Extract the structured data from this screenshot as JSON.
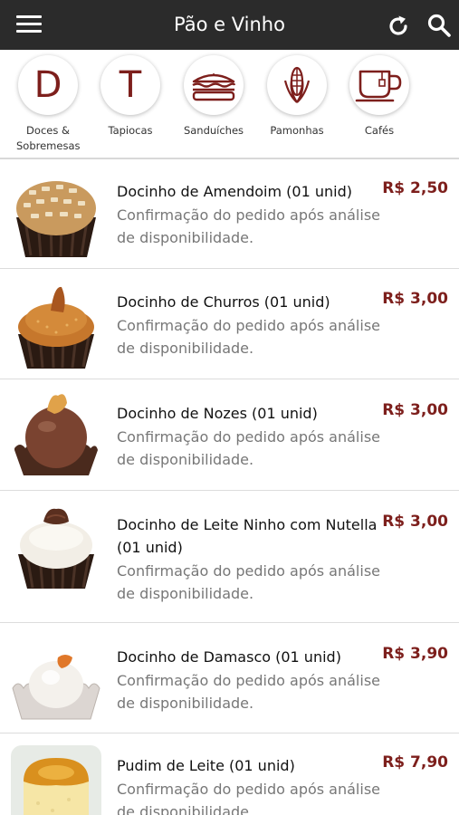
{
  "app": {
    "title": "Pão e Vinho"
  },
  "categories": [
    {
      "label": "Doces & Sobremesas",
      "letter": "D"
    },
    {
      "label": "Tapiocas",
      "letter": "T"
    },
    {
      "label": "Sanduíches",
      "icon": "sandwich-icon"
    },
    {
      "label": "Pamonhas",
      "icon": "corn-icon"
    },
    {
      "label": "Cafés",
      "icon": "coffee-cup-icon"
    }
  ],
  "products": [
    {
      "name": "Docinho de Amendoim (01 unid)",
      "desc": "Confirmação do pedido após análise de disponibilidade.",
      "price": "R$ 2,50"
    },
    {
      "name": "Docinho de Churros (01 unid)",
      "desc": "Confirmação do pedido após análise de disponibilidade.",
      "price": "R$ 3,00"
    },
    {
      "name": "Docinho de Nozes (01 unid)",
      "desc": "Confirmação do pedido após análise de disponibilidade.",
      "price": "R$ 3,00"
    },
    {
      "name": "Docinho de Leite Ninho com Nutella (01 unid)",
      "desc": "Confirmação do pedido após análise de disponibilidade.",
      "price": "R$ 3,00"
    },
    {
      "name": "Docinho de Damasco (01 unid)",
      "desc": "Confirmação do pedido após análise de disponibilidade.",
      "price": "R$ 3,90"
    },
    {
      "name": "Pudim de Leite (01 unid)",
      "desc": "Confirmação do pedido após análise de disponibilidade.",
      "price": "R$ 7,90"
    }
  ],
  "colors": {
    "appbar": "#2b2b2b",
    "accent": "#7d1f1c",
    "desc_text": "#777777"
  }
}
